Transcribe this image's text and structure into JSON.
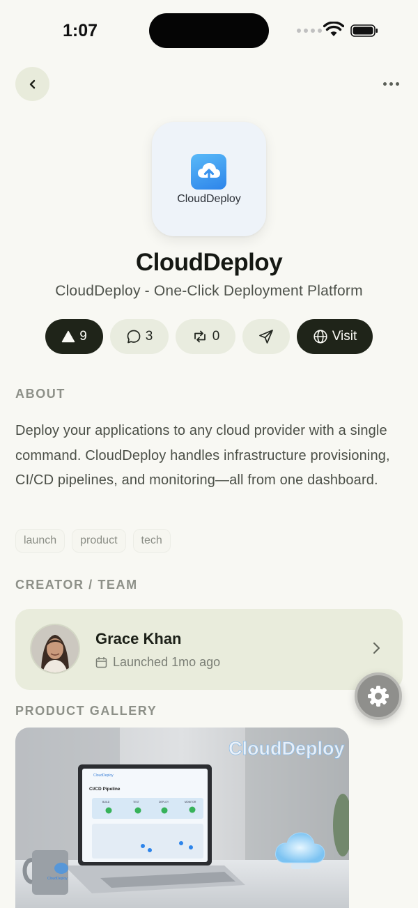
{
  "status_bar": {
    "time": "1:07"
  },
  "nav": {
    "back_icon": "chevron-left-icon",
    "more_icon": "more-horizontal-icon"
  },
  "app": {
    "logo_label": "CloudDeploy",
    "name": "CloudDeploy",
    "tagline": "CloudDeploy - One-Click Deployment Platform"
  },
  "actions": {
    "upvotes": "9",
    "comments": "3",
    "reposts": "0",
    "visit_label": "Visit"
  },
  "about": {
    "heading": "ABOUT",
    "description": "Deploy your applications to any cloud provider with a single command. CloudDeploy handles infrastructure provisioning, CI/CD pipelines, and monitoring—all from one dashboard.",
    "tags": [
      "launch",
      "product",
      "tech"
    ]
  },
  "creator": {
    "heading": "CREATOR / TEAM",
    "name": "Grace Khan",
    "launched": "Launched 1mo ago"
  },
  "gallery": {
    "heading": "PRODUCT GALLERY",
    "sign_text": "CloudDeploy",
    "screen_brand": "CloudDeploy",
    "screen_title": "CI/CD Pipeline",
    "stages": [
      "BUILD",
      "TEST",
      "DEPLOY",
      "MONITOR"
    ],
    "mug_text": "CloudDeploy"
  },
  "colors": {
    "dark_pill": "#1f2419",
    "pill": "#e9ecdf",
    "background": "#f8f8f3",
    "accent_blue": "#2d84ea"
  }
}
